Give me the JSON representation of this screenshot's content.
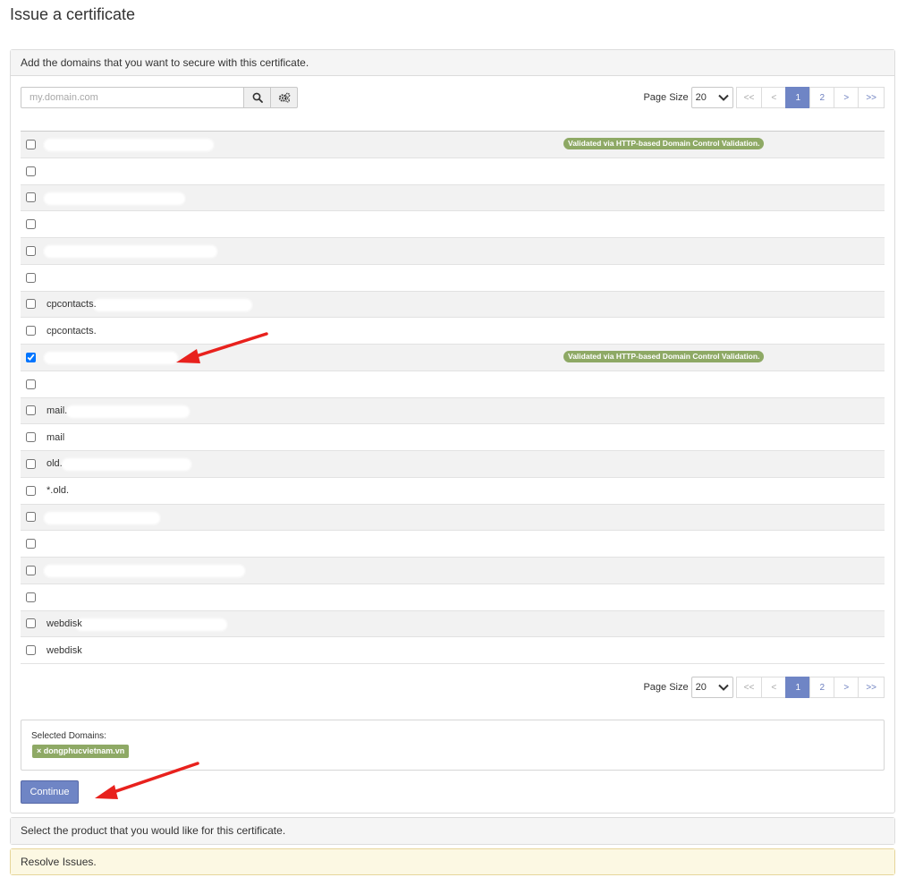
{
  "page": {
    "title": "Issue a certificate"
  },
  "domains_panel": {
    "header": "Add the domains that you want to secure with this certificate.",
    "search": {
      "placeholder": "my.domain.com",
      "value": ""
    },
    "icons": {
      "search": "search-icon",
      "settings": "gears-icon"
    },
    "pagination": {
      "page_size_label": "Page Size",
      "page_size_value": "20",
      "buttons": [
        "<<",
        "<",
        "1",
        "2",
        ">",
        ">>"
      ],
      "active_page": "1"
    },
    "rows": [
      {
        "label": "",
        "checked": false,
        "badge": "Validated via HTTP-based Domain Control Validation."
      },
      {
        "label": "",
        "checked": false,
        "badge": ""
      },
      {
        "label": "",
        "checked": false,
        "badge": ""
      },
      {
        "label": "",
        "checked": false,
        "badge": ""
      },
      {
        "label": "",
        "checked": false,
        "badge": ""
      },
      {
        "label": "",
        "checked": false,
        "badge": ""
      },
      {
        "label": "cpcontacts.",
        "checked": false,
        "badge": ""
      },
      {
        "label": "cpcontacts.",
        "checked": false,
        "badge": ""
      },
      {
        "label": "",
        "checked": true,
        "badge": "Validated via HTTP-based Domain Control Validation."
      },
      {
        "label": "",
        "checked": false,
        "badge": ""
      },
      {
        "label": "mail.",
        "checked": false,
        "badge": ""
      },
      {
        "label": "mail",
        "checked": false,
        "badge": ""
      },
      {
        "label": "old.",
        "checked": false,
        "badge": ""
      },
      {
        "label": "*.old.",
        "checked": false,
        "badge": ""
      },
      {
        "label": "",
        "checked": false,
        "badge": ""
      },
      {
        "label": "",
        "checked": false,
        "badge": ""
      },
      {
        "label": "",
        "checked": false,
        "badge": ""
      },
      {
        "label": "",
        "checked": false,
        "badge": ""
      },
      {
        "label": "webdisk",
        "checked": false,
        "badge": ""
      },
      {
        "label": "webdisk",
        "checked": false,
        "badge": ""
      }
    ],
    "selected": {
      "label": "Selected Domains:",
      "chips": [
        {
          "remove": "×",
          "text": "dongphucvietnam.vn"
        }
      ]
    },
    "continue_label": "Continue"
  },
  "product_panel": {
    "header": "Select the product that you would like for this certificate."
  },
  "issues_panel": {
    "header": "Resolve Issues."
  },
  "colors": {
    "primary": "#6f85c5",
    "badge_green": "#8ea965",
    "warning_bg": "#fcf8e3",
    "annotation_red": "#e8211d"
  }
}
